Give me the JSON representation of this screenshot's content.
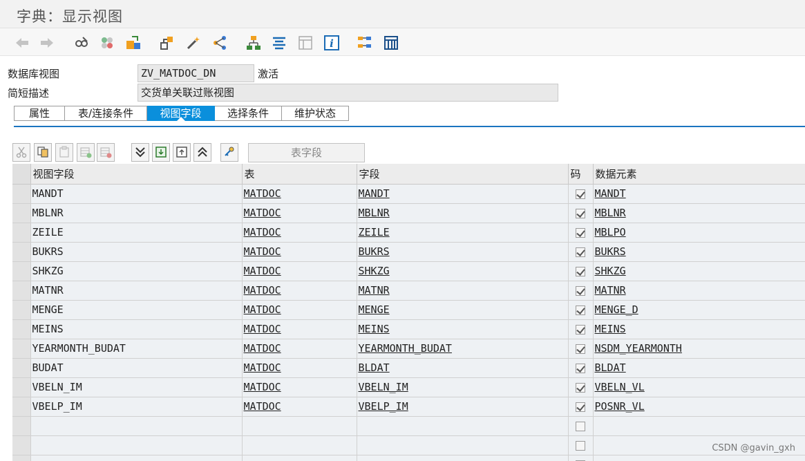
{
  "window": {
    "title": "字典：显示视图"
  },
  "toolbar": {
    "icons": [
      "back-arrow-icon",
      "forward-arrow-icon",
      "display-change-icon",
      "other-object-icon",
      "activate-icon",
      "where-used-icon",
      "magic-wand-icon",
      "hierarchy-icon",
      "org-chart-icon",
      "sort-icon",
      "table-layout-icon",
      "info-icon",
      "tree-icon",
      "grid-icon"
    ]
  },
  "form": {
    "view_label": "数据库视图",
    "view_value": "ZV_MATDOC_DN",
    "view_status": "激活",
    "desc_label": "简短描述",
    "desc_value": "交货单关联过账视图"
  },
  "tabs": [
    {
      "label": "属性",
      "active": false
    },
    {
      "label": "表/连接条件",
      "active": false
    },
    {
      "label": "视图字段",
      "active": true
    },
    {
      "label": "选择条件",
      "active": false
    },
    {
      "label": "维护状态",
      "active": false
    }
  ],
  "table_toolbar": {
    "search_label": "表字段"
  },
  "grid": {
    "headers": {
      "view_field": "视图字段",
      "table": "表",
      "field": "字段",
      "key": "码",
      "data_element": "数据元素"
    },
    "rows": [
      {
        "view_field": "MANDT",
        "table": "MATDOC",
        "field": "MANDT",
        "key": true,
        "data_element": "MANDT"
      },
      {
        "view_field": "MBLNR",
        "table": "MATDOC",
        "field": "MBLNR",
        "key": true,
        "data_element": "MBLNR"
      },
      {
        "view_field": "ZEILE",
        "table": "MATDOC",
        "field": "ZEILE",
        "key": true,
        "data_element": "MBLPO"
      },
      {
        "view_field": "BUKRS",
        "table": "MATDOC",
        "field": "BUKRS",
        "key": true,
        "data_element": "BUKRS"
      },
      {
        "view_field": "SHKZG",
        "table": "MATDOC",
        "field": "SHKZG",
        "key": true,
        "data_element": "SHKZG"
      },
      {
        "view_field": "MATNR",
        "table": "MATDOC",
        "field": "MATNR",
        "key": true,
        "data_element": "MATNR"
      },
      {
        "view_field": "MENGE",
        "table": "MATDOC",
        "field": "MENGE",
        "key": true,
        "data_element": "MENGE_D"
      },
      {
        "view_field": "MEINS",
        "table": "MATDOC",
        "field": "MEINS",
        "key": true,
        "data_element": "MEINS"
      },
      {
        "view_field": "YEARMONTH_BUDAT",
        "table": "MATDOC",
        "field": "YEARMONTH_BUDAT",
        "key": true,
        "data_element": "NSDM_YEARMONTH"
      },
      {
        "view_field": "BUDAT",
        "table": "MATDOC",
        "field": "BLDAT",
        "key": true,
        "data_element": "BLDAT"
      },
      {
        "view_field": "VBELN_IM",
        "table": "MATDOC",
        "field": "VBELN_IM",
        "key": true,
        "data_element": "VBELN_VL"
      },
      {
        "view_field": "VBELP_IM",
        "table": "MATDOC",
        "field": "VBELP_IM",
        "key": true,
        "data_element": "POSNR_VL"
      },
      {
        "view_field": "",
        "table": "",
        "field": "",
        "key": false,
        "data_element": ""
      },
      {
        "view_field": "",
        "table": "",
        "field": "",
        "key": false,
        "data_element": ""
      },
      {
        "view_field": "",
        "table": "",
        "field": "",
        "key": false,
        "data_element": ""
      }
    ]
  },
  "watermark": "CSDN @gavin_gxh"
}
